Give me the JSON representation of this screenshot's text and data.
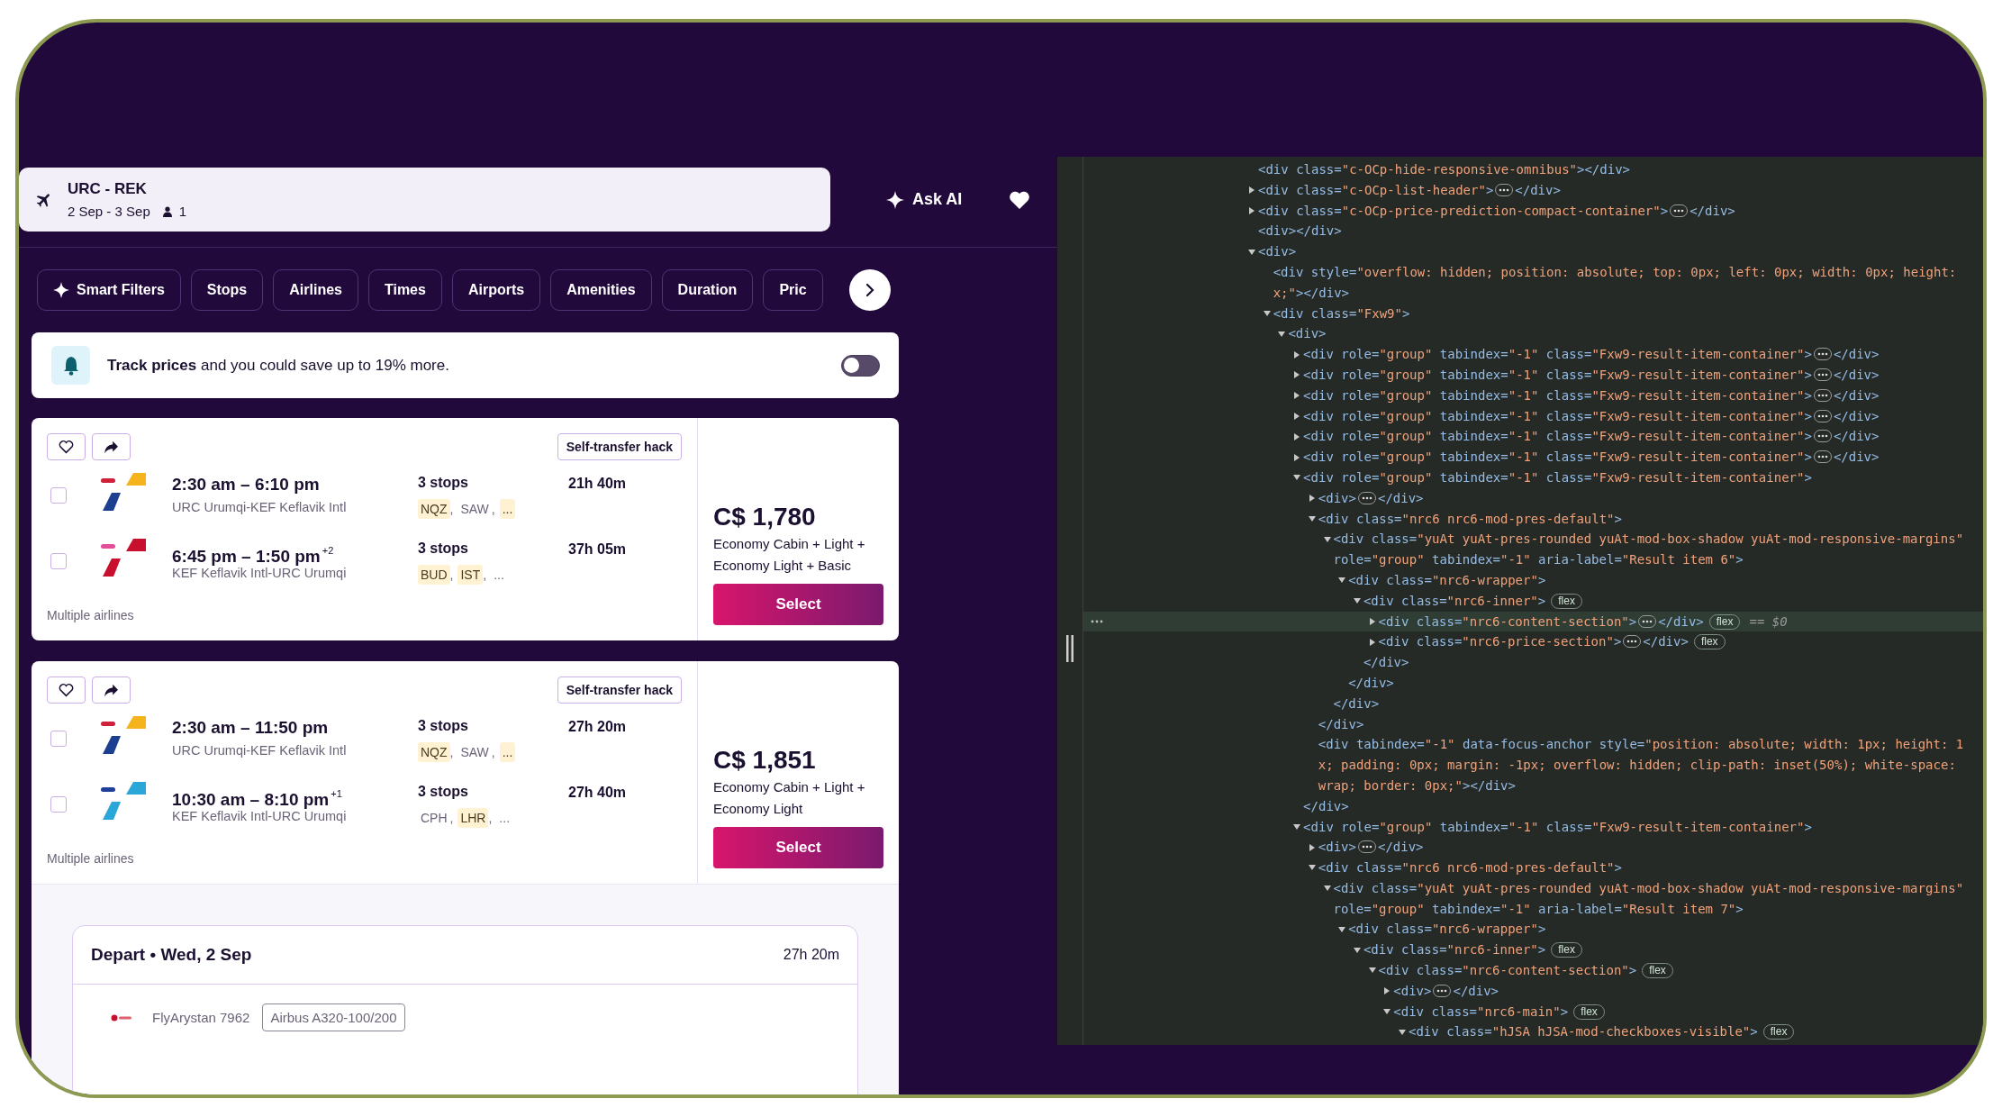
{
  "search": {
    "route": "URC - REK",
    "dates": "2 Sep - 3 Sep",
    "travelers": "1"
  },
  "ask_ai": {
    "label": "Ask AI"
  },
  "filters": [
    {
      "label": "Smart Filters",
      "kind": "smart"
    },
    {
      "label": "Stops",
      "kind": "plain"
    },
    {
      "label": "Airlines",
      "kind": "plain"
    },
    {
      "label": "Times",
      "kind": "plain"
    },
    {
      "label": "Airports",
      "kind": "plain"
    },
    {
      "label": "Amenities",
      "kind": "plain"
    },
    {
      "label": "Duration",
      "kind": "plain"
    },
    {
      "label": "Pric",
      "kind": "plain"
    }
  ],
  "track_prices": {
    "text": "**Track prices** and you could save up to 19% more.",
    "on": false
  },
  "results": [
    {
      "badge": "Self-transfer hack",
      "airlines_note": "Multiple airlines",
      "price": "C$ 1,780",
      "fare": "Economy Cabin + Light + Economy Light + Basic",
      "button": "Select",
      "legs": [
        {
          "checked": false,
          "times": "2:30 am – 6:10 pm",
          "route": "URC Urumqi-KEF Keflavik Intl",
          "stops": "3 stops",
          "duration": "21h 40m",
          "stop_codes": [
            {
              "code": "NQZ",
              "flagged": true,
              "sep": ","
            },
            {
              "code": "SAW",
              "flagged": false,
              "sep": ","
            },
            {
              "code": "...",
              "flagged": true
            }
          ]
        },
        {
          "checked": false,
          "times": "6:45 pm – 1:50 pm",
          "day_offset": "+2",
          "route": "KEF Keflavik Intl-URC Urumqi",
          "stops": "3 stops",
          "duration": "37h 05m",
          "stop_codes": [
            {
              "code": "BUD",
              "flagged": true,
              "sep": ","
            },
            {
              "code": "IST",
              "flagged": true,
              "sep": ","
            },
            {
              "code": "...",
              "flagged": false
            }
          ]
        }
      ]
    },
    {
      "badge": "Self-transfer hack",
      "airlines_note": "Multiple airlines",
      "price": "C$ 1,851",
      "fare": "Economy Cabin + Light + Economy Light",
      "button": "Select",
      "legs": [
        {
          "checked": false,
          "times": "2:30 am – 11:50 pm",
          "route": "URC Urumqi-KEF Keflavik Intl",
          "stops": "3 stops",
          "duration": "27h 20m",
          "stop_codes": [
            {
              "code": "NQZ",
              "flagged": true,
              "sep": ","
            },
            {
              "code": "SAW",
              "flagged": false,
              "sep": ","
            },
            {
              "code": "...",
              "flagged": true
            }
          ]
        },
        {
          "checked": false,
          "times": "10:30 am – 8:10 pm",
          "day_offset": "+1",
          "route": "KEF Keflavik Intl-URC Urumqi",
          "stops": "3 stops",
          "duration": "27h 40m",
          "stop_codes": [
            {
              "code": "CPH",
              "flagged": false,
              "sep": ","
            },
            {
              "code": "LHR",
              "flagged": true,
              "sep": ","
            },
            {
              "code": "...",
              "flagged": false
            }
          ]
        }
      ],
      "details": {
        "title": "Depart • Wed, 2 Sep",
        "duration": "27h 20m",
        "segments": [
          {
            "flight": "FlyArystan 7962",
            "aircraft": "Airbus A320-100/200"
          }
        ]
      }
    }
  ],
  "devtools": {
    "nodes": [
      {
        "open": "<div class=\"c-OCp-hide-responsive-omnibus\"></div>",
        "selected": false
      },
      {
        "open": "<div class=\"c-OCp-list-header\">",
        "close": "</div>",
        "expanded": false,
        "selected": false
      },
      {
        "open": "<div class=\"c-OCp-price-prediction-compact-container\">",
        "close": "</div>",
        "expanded": false,
        "selected": false
      },
      {
        "open": "<div></div>",
        "selected": false
      },
      {
        "open": "<div>",
        "expanded": true,
        "selected": false,
        "children": [
          {
            "open": "<div style=\"overflow: hidden; position: absolute; top: 0px; left: 0px; width: 0px; height:",
            "wrap": [
              "x;\"></div>"
            ],
            "selected": false
          },
          {
            "open": "<div class=\"Fxw9\">",
            "expanded": true,
            "selected": false,
            "children": [
              {
                "open": "<div>",
                "expanded": true,
                "selected": false,
                "children": [
                  {
                    "open": "<div role=\"group\" tabindex=\"-1\" class=\"Fxw9-result-item-container\">",
                    "close": "</div>",
                    "expanded": false,
                    "selected": false
                  },
                  {
                    "open": "<div role=\"group\" tabindex=\"-1\" class=\"Fxw9-result-item-container\">",
                    "close": "</div>",
                    "expanded": false,
                    "selected": false
                  },
                  {
                    "open": "<div role=\"group\" tabindex=\"-1\" class=\"Fxw9-result-item-container\">",
                    "close": "</div>",
                    "expanded": false,
                    "selected": false
                  },
                  {
                    "open": "<div role=\"group\" tabindex=\"-1\" class=\"Fxw9-result-item-container\">",
                    "close": "</div>",
                    "expanded": false,
                    "selected": false
                  },
                  {
                    "open": "<div role=\"group\" tabindex=\"-1\" class=\"Fxw9-result-item-container\">",
                    "close": "</div>",
                    "expanded": false,
                    "selected": false
                  },
                  {
                    "open": "<div role=\"group\" tabindex=\"-1\" class=\"Fxw9-result-item-container\">",
                    "close": "</div>",
                    "expanded": false,
                    "selected": false
                  },
                  {
                    "open": "<div role=\"group\" tabindex=\"-1\" class=\"Fxw9-result-item-container\">",
                    "close": "</div>",
                    "expanded": true,
                    "selected": false,
                    "children": [
                      {
                        "open": "<div>",
                        "close": "</div>",
                        "expanded": false,
                        "selected": false
                      },
                      {
                        "open": "<div class=\"nrc6 nrc6-mod-pres-default\">",
                        "close": "</div>",
                        "expanded": true,
                        "selected": false,
                        "children": [
                          {
                            "open": "<div class=\"yuAt yuAt-pres-rounded yuAt-mod-box-shadow yuAt-mod-responsive-margins\"",
                            "wrap": [
                              "role=\"group\" tabindex=\"-1\" aria-label=\"Result item 6\">"
                            ],
                            "close": "</div>",
                            "expanded": true,
                            "selected": false,
                            "children": [
                              {
                                "open": "<div class=\"nrc6-wrapper\">",
                                "close": "</div>",
                                "expanded": true,
                                "selected": false,
                                "children": [
                                  {
                                    "open": "<div class=\"nrc6-inner\">",
                                    "badges": [
                                      "flex"
                                    ],
                                    "close": "</div>",
                                    "expanded": true,
                                    "selected": false,
                                    "children": [
                                      {
                                        "open": "<div class=\"nrc6-content-section\">",
                                        "close": "</div>",
                                        "expanded": false,
                                        "badges": [
                                          "flex"
                                        ],
                                        "note": "== $0",
                                        "selected": true
                                      },
                                      {
                                        "open": "<div class=\"nrc6-price-section\">",
                                        "close": "</div>",
                                        "expanded": false,
                                        "badges": [
                                          "flex"
                                        ],
                                        "selected": false
                                      }
                                    ]
                                  }
                                ]
                              }
                            ]
                          }
                        ]
                      },
                      {
                        "open": "<div tabindex=\"-1\" data-focus-anchor style=\"position: absolute; width: 1px; height: 1",
                        "wrap": [
                          "x; padding: 0px; margin: -1px; overflow: hidden; clip-path: inset(50%); white-space:",
                          "wrap; border: 0px;\"></div>"
                        ],
                        "selected": false
                      }
                    ]
                  },
                  {
                    "open": "<div role=\"group\" tabindex=\"-1\" class=\"Fxw9-result-item-container\">",
                    "expanded": true,
                    "selected": false,
                    "children": [
                      {
                        "open": "<div>",
                        "close": "</div>",
                        "expanded": false,
                        "selected": false
                      },
                      {
                        "open": "<div class=\"nrc6 nrc6-mod-pres-default\">",
                        "expanded": true,
                        "selected": false,
                        "children": [
                          {
                            "open": "<div class=\"yuAt yuAt-pres-rounded yuAt-mod-box-shadow yuAt-mod-responsive-margins\"",
                            "wrap": [
                              "role=\"group\" tabindex=\"-1\" aria-label=\"Result item 7\">"
                            ],
                            "expanded": true,
                            "selected": false,
                            "children": [
                              {
                                "open": "<div class=\"nrc6-wrapper\">",
                                "expanded": true,
                                "selected": false,
                                "children": [
                                  {
                                    "open": "<div class=\"nrc6-inner\">",
                                    "badges": [
                                      "flex"
                                    ],
                                    "expanded": true,
                                    "selected": false,
                                    "children": [
                                      {
                                        "open": "<div class=\"nrc6-content-section\">",
                                        "badges": [
                                          "flex"
                                        ],
                                        "expanded": true,
                                        "selected": false,
                                        "children": [
                                          {
                                            "open": "<div>",
                                            "close": "</div>",
                                            "expanded": false,
                                            "selected": false
                                          },
                                          {
                                            "open": "<div class=\"nrc6-main\">",
                                            "badges": [
                                              "flex"
                                            ],
                                            "expanded": true,
                                            "selected": false,
                                            "children": [
                                              {
                                                "open": "<div class=\"hJSA hJSA-mod-checkboxes-visible\">",
                                                "badges": [
                                                  "flex"
                                                ],
                                                "expanded": true,
                                                "selected": false
                                              }
                                            ]
                                          }
                                        ]
                                      }
                                    ]
                                  }
                                ]
                              }
                            ]
                          }
                        ]
                      }
                    ]
                  }
                ]
              }
            ]
          }
        ]
      }
    ]
  }
}
